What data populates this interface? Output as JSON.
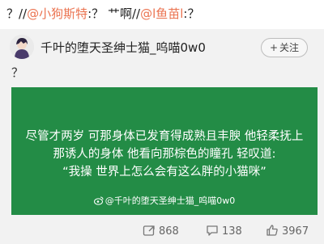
{
  "repost": {
    "prefix": "？//",
    "mention1": "@小狗斯特",
    "middle": ":？ 艹啊//",
    "mention2": "@l鱼苗l",
    "suffix": ":？"
  },
  "post": {
    "username": "千叶的堕天圣绅士猫_呜喵0w0",
    "follow_label": "关注",
    "text": "？",
    "image": {
      "line1": "尽管才两岁 可那身体已发育得成熟且丰腴 他轻柔抚上",
      "line2": "那诱人的身体 他看向那棕色的瞳孔 轻叹道:",
      "line3": "“我操 世界上怎么会有这么胖的小猫咪”",
      "watermark": "@千叶的堕天圣绅士猫_呜喵0w0"
    }
  },
  "stats": {
    "reposts": "868",
    "comments": "138",
    "likes": "3967"
  },
  "colors": {
    "mention": "#eb7350",
    "card_green": "#238c46"
  },
  "icons": [
    "avatar-image",
    "plus-icon",
    "weibo-logo-icon",
    "repost-icon",
    "comment-icon",
    "like-icon"
  ]
}
